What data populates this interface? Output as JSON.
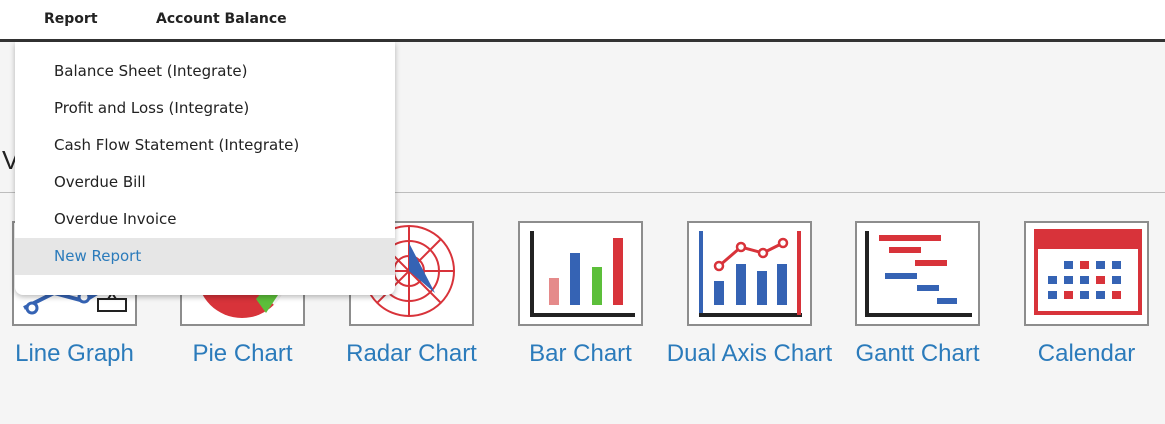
{
  "topbar": {
    "report_label": "Report",
    "account_balance_label": "Account Balance"
  },
  "dropdown": {
    "items": [
      {
        "label": "Balance Sheet (Integrate)"
      },
      {
        "label": "Profit and Loss (Integrate)"
      },
      {
        "label": "Cash Flow Statement (Integrate)"
      },
      {
        "label": "Overdue Bill"
      },
      {
        "label": "Overdue Invoice"
      },
      {
        "label": "New Report",
        "active": true
      }
    ]
  },
  "section": {
    "title_visible_fragment": "V"
  },
  "tiles": [
    {
      "label": "Line Graph",
      "icon": "line-graph-icon"
    },
    {
      "label": "Pie Chart",
      "icon": "pie-chart-icon"
    },
    {
      "label": "Radar Chart",
      "icon": "radar-chart-icon"
    },
    {
      "label": "Bar Chart",
      "icon": "bar-chart-icon"
    },
    {
      "label": "Dual Axis Chart",
      "icon": "dual-axis-chart-icon"
    },
    {
      "label": "Gantt Chart",
      "icon": "gantt-chart-icon"
    },
    {
      "label": "Calendar",
      "icon": "calendar-icon"
    }
  ],
  "colors": {
    "link_blue": "#2b7bbb",
    "icon_red": "#d8333a",
    "icon_blue": "#3563b4",
    "icon_green": "#5cbf3a",
    "icon_pink": "#e58a8a"
  }
}
